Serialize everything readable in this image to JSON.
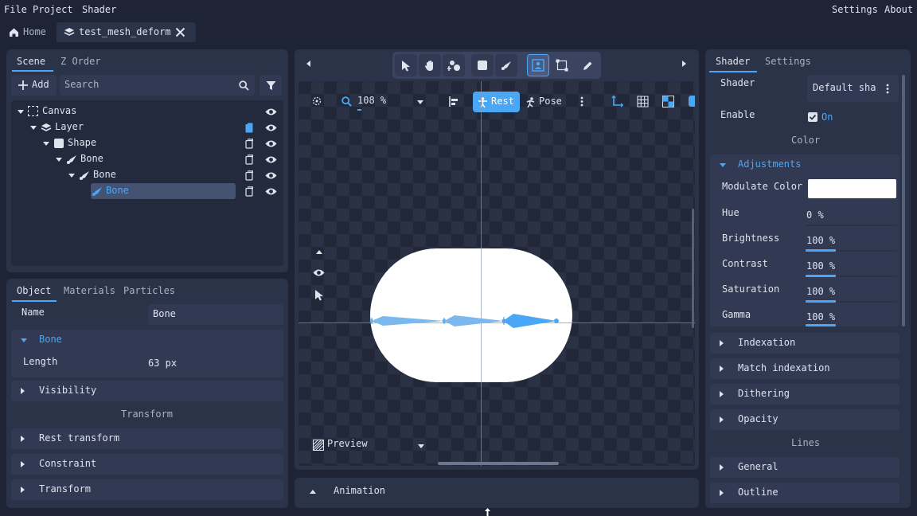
{
  "menu": {
    "file": "File",
    "project": "Project",
    "shader": "Shader",
    "settings": "Settings",
    "about": "About"
  },
  "tabs": {
    "home": "Home",
    "active": "test_mesh_deform"
  },
  "scene_panel": {
    "tabs": [
      "Scene",
      "Z Order"
    ],
    "add_label": "Add",
    "search_placeholder": "Search",
    "tree": [
      {
        "label": "Canvas",
        "depth": 0
      },
      {
        "label": "Layer",
        "depth": 1
      },
      {
        "label": "Shape",
        "depth": 2
      },
      {
        "label": "Bone",
        "depth": 3
      },
      {
        "label": "Bone",
        "depth": 4
      },
      {
        "label": "Bone",
        "depth": 5,
        "selected": true
      }
    ]
  },
  "object_panel": {
    "tabs": [
      "Object",
      "Materials",
      "Particles"
    ],
    "name_label": "Name",
    "name_value": "Bone",
    "bone_section": "Bone",
    "length_label": "Length",
    "length_value": "63 px",
    "visibility": "Visibility",
    "transform_header": "Transform",
    "rest_transform": "Rest transform",
    "constraint": "Constraint",
    "transform": "Transform"
  },
  "viewport": {
    "zoom": "108 %",
    "rest_label": "Rest",
    "pose_label": "Pose",
    "preview_label": "Preview"
  },
  "animation": {
    "label": "Animation"
  },
  "shader_panel": {
    "tabs": [
      "Shader",
      "Settings"
    ],
    "shader_label": "Shader",
    "shader_value": "Default sha",
    "enable_label": "Enable",
    "enable_value": "On",
    "color_header": "Color",
    "adjustments": "Adjustments",
    "modulate_label": "Modulate Color",
    "rows": [
      {
        "label": "Hue",
        "value": "0 %",
        "fill": 0
      },
      {
        "label": "Brightness",
        "value": "100 %",
        "fill": 0.33
      },
      {
        "label": "Contrast",
        "value": "100 %",
        "fill": 0.33
      },
      {
        "label": "Saturation",
        "value": "100 %",
        "fill": 0.33
      },
      {
        "label": "Gamma",
        "value": "100 %",
        "fill": 0.33
      }
    ],
    "indexation": "Indexation",
    "match_indexation": "Match indexation",
    "dithering": "Dithering",
    "opacity": "Opacity",
    "lines_header": "Lines",
    "general": "General",
    "outline": "Outline"
  },
  "colors": {
    "accent": "#4aa7f5",
    "panel": "#2b3349",
    "bg": "#1e2436"
  }
}
